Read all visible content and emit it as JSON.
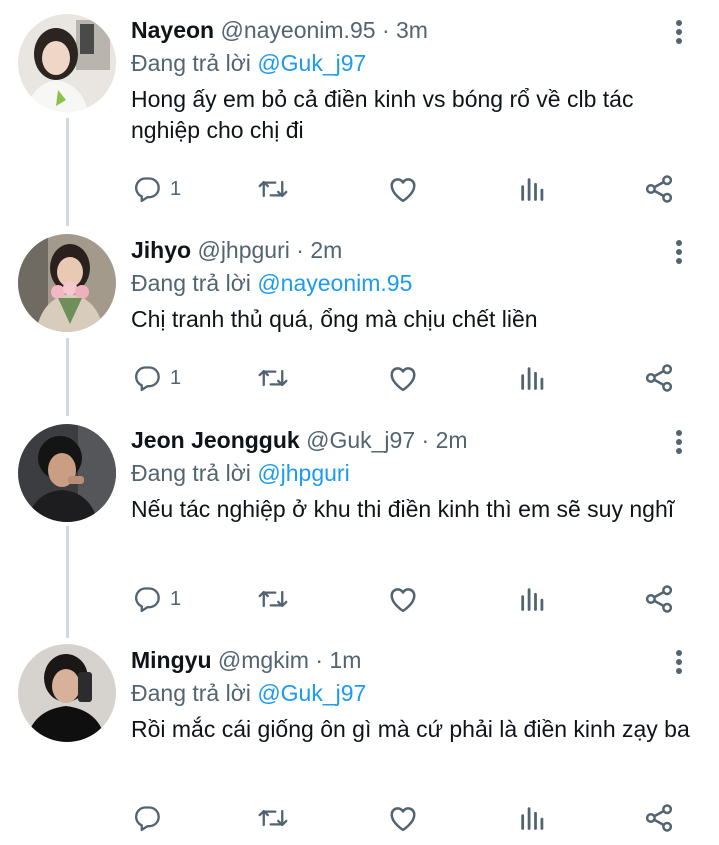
{
  "tweets": [
    {
      "name": "Nayeon",
      "handle": "@nayeonim.95",
      "sep": "·",
      "time": "3m",
      "reply_prefix": "Đang trả lời",
      "reply_to": "@Guk_j97",
      "text": "Hong ấy em bỏ cả điền kinh vs bóng rổ về clb tác nghiệp cho chị đi",
      "reply_count": "1"
    },
    {
      "name": "Jihyo",
      "handle": "@jhpguri",
      "sep": "·",
      "time": "2m",
      "reply_prefix": "Đang trả lời",
      "reply_to": "@nayeonim.95",
      "text": "Chị tranh thủ quá, ổng mà chịu chết liền",
      "reply_count": "1"
    },
    {
      "name": "Jeon Jeongguk",
      "handle": "@Guk_j97",
      "sep": "·",
      "time": "2m",
      "reply_prefix": "Đang trả lời",
      "reply_to": "@jhpguri",
      "text": "Nếu tác nghiệp ở khu thi điền kinh thì em sẽ suy nghĩ",
      "reply_count": "1"
    },
    {
      "name": "Mingyu",
      "handle": "@mgkim",
      "sep": "·",
      "time": "1m",
      "reply_prefix": "Đang trả lời",
      "reply_to": "@Guk_j97",
      "text": "Rồi mắc cái giống ôn gì mà cứ phải là điền kinh zạy ba",
      "reply_count": ""
    }
  ],
  "icons": [
    "comment-icon",
    "retweet-icon",
    "like-icon",
    "analytics-icon",
    "share-icon",
    "more-options-icon"
  ],
  "colors": {
    "text": "#0f1419",
    "secondary": "#536471",
    "accent": "#1d9bf0",
    "thread_line": "#cfd9de"
  }
}
